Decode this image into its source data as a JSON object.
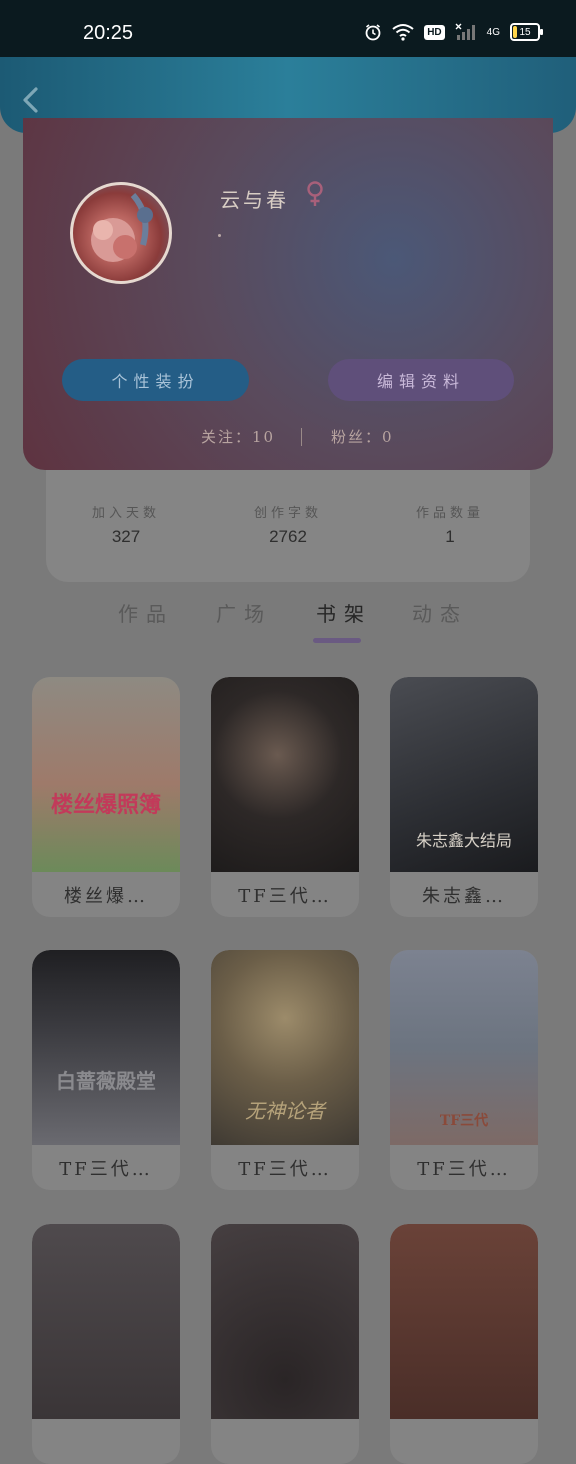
{
  "status_bar": {
    "time": "20:25",
    "hd_label": "HD",
    "network": "4G",
    "battery": "15",
    "icons": [
      "alarm-icon",
      "wifi-icon",
      "signal-icon",
      "battery-icon"
    ]
  },
  "header": {
    "back_icon": "chevron-left-icon"
  },
  "profile": {
    "username": "云与春",
    "gender_icon": "female-icon",
    "bio": "·",
    "buttons": {
      "decorate": "个性装扮",
      "edit": "编辑资料"
    },
    "following": "关注：10",
    "fans": "粉丝：0"
  },
  "stats": [
    {
      "label": "加入天数",
      "value": "327"
    },
    {
      "label": "创作字数",
      "value": "2762"
    },
    {
      "label": "作品数量",
      "value": "1"
    }
  ],
  "tabs": [
    "作品",
    "广场",
    "书架",
    "动态"
  ],
  "active_tab": "书架",
  "books": [
    {
      "title": "楼丝爆…",
      "cover_text": "楼丝爆照簿",
      "cover_color": "#9a8470"
    },
    {
      "title": "TF三代…",
      "cover_text": "",
      "cover_color": "#2f2b2a"
    },
    {
      "title": "朱志鑫…",
      "cover_text": "朱志鑫大结局",
      "cover_color": "#3a3d44"
    },
    {
      "title": "TF三代…",
      "cover_text": "白蔷薇殿堂",
      "cover_color": "#2e2e30"
    },
    {
      "title": "TF三代…",
      "cover_text": "无神论者",
      "cover_color": "#5b5447"
    },
    {
      "title": "TF三代…",
      "cover_text": "TF三代",
      "cover_color": "#6a6f7a"
    },
    {
      "title": "",
      "cover_text": "",
      "cover_color": "#4a4548"
    },
    {
      "title": "",
      "cover_text": "",
      "cover_color": "#3a3436"
    },
    {
      "title": "",
      "cover_text": "",
      "cover_color": "#5a3a33"
    }
  ]
}
